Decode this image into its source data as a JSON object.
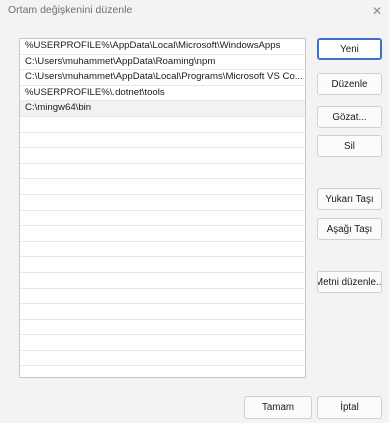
{
  "window": {
    "title": "Ortam değişkenini düzenle",
    "close_glyph": "✕"
  },
  "list": {
    "items": [
      "%USERPROFILE%\\AppData\\Local\\Microsoft\\WindowsApps",
      "C:\\Users\\muhammet\\AppData\\Roaming\\npm",
      "C:\\Users\\muhammet\\AppData\\Local\\Programs\\Microsoft VS Co...",
      "%USERPROFILE%\\.dotnet\\tools",
      "C:\\mingw64\\bin"
    ],
    "selected_index": 4,
    "empty_rows": 16
  },
  "buttons": {
    "new": "Yeni",
    "edit": "Düzenle",
    "browse": "Gözat...",
    "delete": "Sil",
    "move_up": "Yukarı Taşı",
    "move_down": "Aşağı Taşı",
    "edit_text": "Metni düzenle...",
    "ok": "Tamam",
    "cancel": "İptal"
  },
  "colors": {
    "accent": "#3f70c8",
    "selection": "#f2f2f2"
  }
}
